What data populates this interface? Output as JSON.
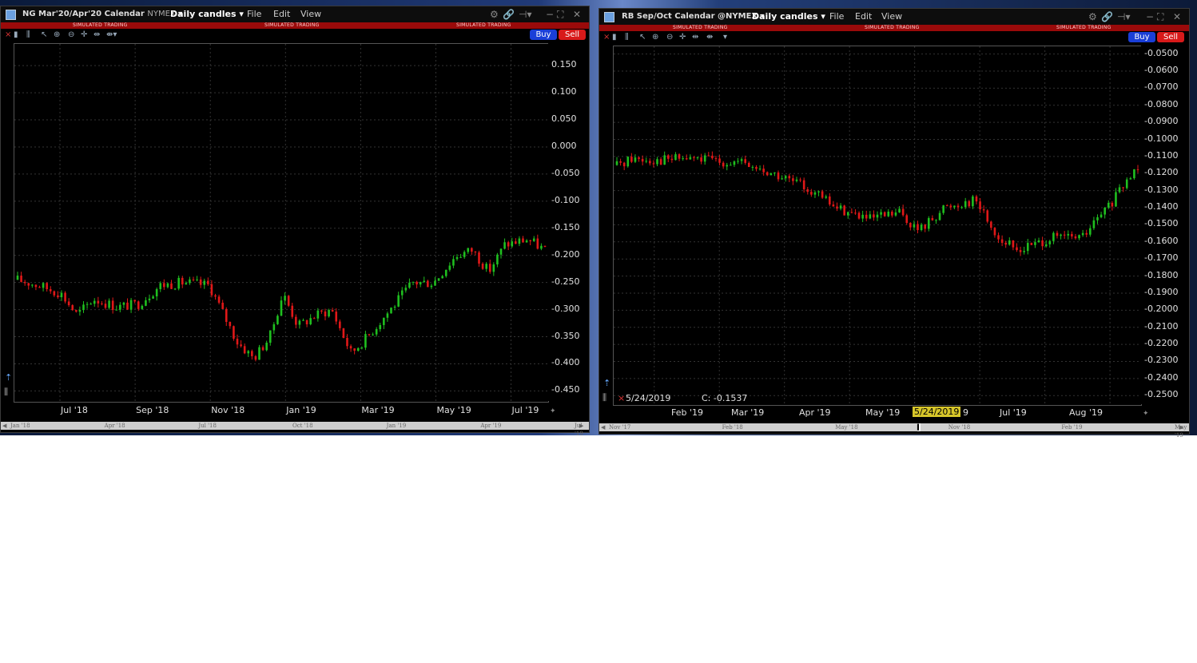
{
  "left": {
    "title": {
      "symbol": "NG Mar'20/Apr'20 Calendar",
      "exchange": "NYMEX",
      "mode": "Daily candles"
    },
    "menu": [
      "File",
      "Edit",
      "View"
    ],
    "sim_label": "SIMULATED TRADING",
    "buy_label": "Buy",
    "sell_label": "Sell",
    "y_ticks": [
      "0.150",
      "0.100",
      "0.050",
      "0.000",
      "-0.050",
      "-0.100",
      "-0.150",
      "-0.200",
      "-0.250",
      "-0.300",
      "-0.350",
      "-0.400",
      "-0.450"
    ],
    "x_ticks": [
      "Jul '18",
      "Sep '18",
      "Nov '18",
      "Jan '19",
      "Mar '19",
      "May '19",
      "Jul '19"
    ],
    "nav_ticks": [
      "Jan '18",
      "Apr '18",
      "Jul '18",
      "Oct '18",
      "Jan '19",
      "Apr '19",
      "Jul '19"
    ]
  },
  "right": {
    "title": {
      "symbol": "RB Sep/Oct Calendar @NYMEX",
      "mode": "Daily candles"
    },
    "menu": [
      "File",
      "Edit",
      "View"
    ],
    "sim_label": "SIMULATED TRADING",
    "buy_label": "Buy",
    "sell_label": "Sell",
    "y_ticks": [
      "-0.0500",
      "-0.0600",
      "-0.0700",
      "-0.0800",
      "-0.0900",
      "-0.1000",
      "-0.1100",
      "-0.1200",
      "-0.1300",
      "-0.1400",
      "-0.1500",
      "-0.1600",
      "-0.1700",
      "-0.1800",
      "-0.1900",
      "-0.2000",
      "-0.2100",
      "-0.2200",
      "-0.2300",
      "-0.2400",
      "-0.2500"
    ],
    "x_ticks": [
      "Feb '19",
      "Mar '19",
      "Apr '19",
      "May '19",
      "Jul '19",
      "Aug '19"
    ],
    "crosshair_date": "5/24/2019",
    "crosshair_suffix": "9",
    "info_date": "5/24/2019",
    "info_close": "C: -0.1537",
    "nav_ticks": [
      "Nov '17",
      "Feb '18",
      "May '18",
      "Nov '18",
      "Feb '19",
      "May '19"
    ]
  },
  "chart_data": [
    {
      "type": "line",
      "title": "NG Mar'20/Apr'20 Calendar",
      "ylim": [
        -0.47,
        0.19
      ],
      "series": [
        {
          "x": [
            "2018-05-01",
            "2018-05-20",
            "2018-06-10",
            "2018-06-25",
            "2018-07-10",
            "2018-08-01",
            "2018-08-20",
            "2018-09-10",
            "2018-10-01",
            "2018-10-25",
            "2018-11-05",
            "2018-11-20",
            "2018-12-05",
            "2018-12-20",
            "2019-01-01",
            "2019-01-15",
            "2019-02-01",
            "2019-02-15",
            "2019-03-05",
            "2019-03-20",
            "2019-04-10",
            "2019-05-01",
            "2019-05-20",
            "2019-06-10",
            "2019-06-25",
            "2019-07-10",
            "2019-07-25",
            "2019-08-15",
            "2019-08-31"
          ],
          "values": [
            -0.245,
            -0.255,
            -0.27,
            -0.31,
            -0.28,
            -0.295,
            -0.29,
            -0.255,
            -0.25,
            -0.255,
            -0.3,
            -0.36,
            -0.39,
            -0.35,
            -0.27,
            -0.33,
            -0.31,
            -0.3,
            -0.38,
            -0.35,
            -0.3,
            -0.25,
            -0.25,
            -0.2,
            -0.19,
            -0.23,
            -0.18,
            -0.17,
            -0.19
          ]
        }
      ]
    },
    {
      "type": "line",
      "title": "RB Sep/Oct Calendar",
      "ylim": [
        -0.2555,
        -0.0455
      ],
      "series": [
        {
          "x": [
            "2019-01-01",
            "2019-01-08",
            "2019-01-20",
            "2019-02-01",
            "2019-02-15",
            "2019-03-01",
            "2019-03-15",
            "2019-04-01",
            "2019-04-15",
            "2019-05-01",
            "2019-05-15",
            "2019-05-24",
            "2019-06-05",
            "2019-06-20",
            "2019-07-01",
            "2019-07-10",
            "2019-07-25",
            "2019-08-10",
            "2019-08-25",
            "2019-09-05"
          ],
          "values": [
            -0.115,
            -0.111,
            -0.112,
            -0.111,
            -0.112,
            -0.114,
            -0.12,
            -0.128,
            -0.14,
            -0.147,
            -0.143,
            -0.1537,
            -0.14,
            -0.135,
            -0.158,
            -0.165,
            -0.158,
            -0.157,
            -0.135,
            -0.115
          ]
        }
      ]
    }
  ]
}
